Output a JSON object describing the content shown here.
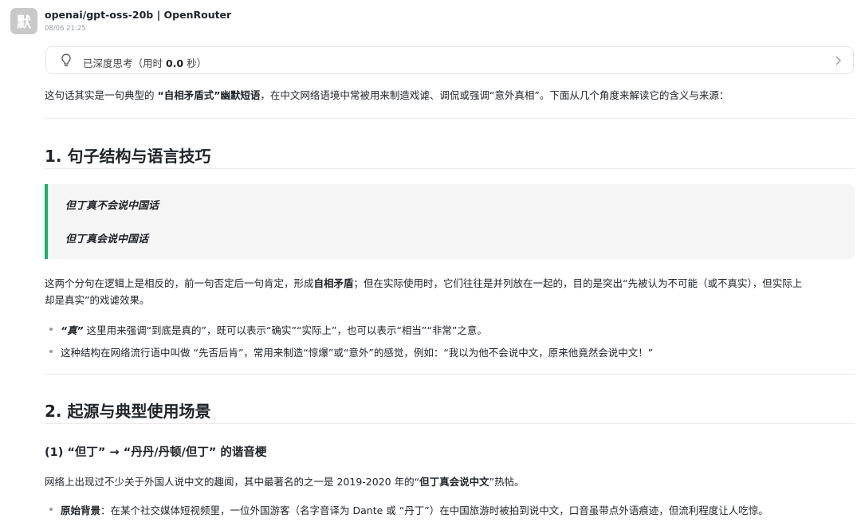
{
  "header": {
    "avatar_char": "默",
    "model_name": "openai/gpt-oss-20b | OpenRouter",
    "timestamp": "08/06 21:25"
  },
  "thinking": {
    "prefix": "已深度思考（用时 ",
    "seconds": "0.0",
    "suffix": " 秒）"
  },
  "intro": {
    "p1": "这句话其实是一句典型的 ",
    "b1": "“自相矛盾式”幽默短语",
    "p2": "，在中文网络语境中常被用来制造戏谑、调侃或强调“意外真相”。下面从几个角度来解读它的含义与来源："
  },
  "section1": {
    "heading": "1. 句子结构与语言技巧",
    "quote_line1": "但丁真不会说中国话",
    "quote_line2": "但丁真会说中国话",
    "para_a": "这两个分句在逻辑上是相反的，前一句否定后一句肯定，形成",
    "para_b": "自相矛盾",
    "para_c": "；但在实际使用时，它们往往是并列放在一起的，目的是突出“先被认为不可能（或不真实），但实际上",
    "para_d": "却是真实”的戏谑效果。",
    "bullet1_bold": "“真”",
    "bullet1_text": " 这里用来强调“到底是真的”，既可以表示“确实”“实际上”，也可以表示“相当”“非常”之意。",
    "bullet2_text": "这种结构在网络流行语中叫做 “先否后肯”，常用来制造“惊爆”或“意外”的感觉，例如：“我以为他不会说中文，原来他竟然会说中文！”"
  },
  "section2": {
    "heading": "2. 起源与典型使用场景",
    "subheading": "(1) “但丁” → “丹丹/丹顿/但丁” 的谐音梗",
    "para_a": "网络上出现过不少关于外国人说中文的趣闻，其中最著名的之一是 2019-2020 年的“",
    "para_b": "但丁真会说中文",
    "para_c": "”热帖。",
    "bullet1_bold": "原始背景",
    "bullet1_text": "：在某个社交媒体短视频里，一位外国游客（名字音译为 Dante 或 “丹丁”）在中国旅游时被拍到说中文，口音虽带点外语痕迹，但流利程度让人吃惊。"
  }
}
